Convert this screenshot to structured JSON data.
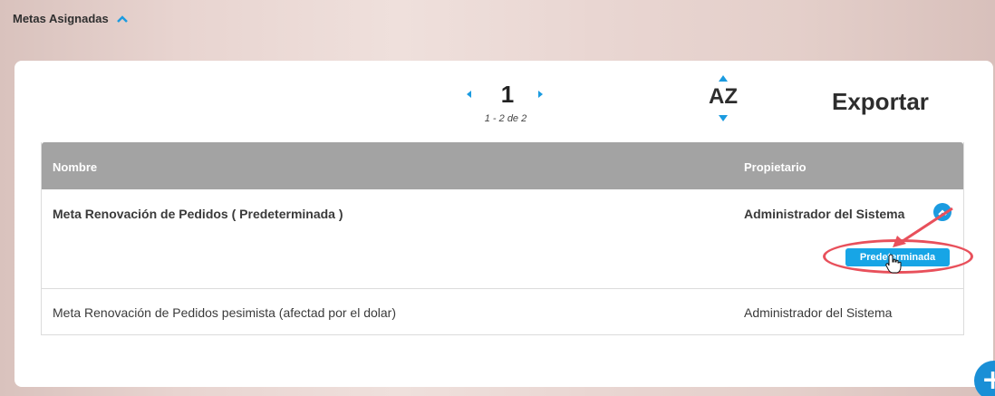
{
  "section": {
    "title": "Metas Asignadas"
  },
  "pagination": {
    "current_page": "1",
    "range": "1 - 2 de 2"
  },
  "sort": {
    "label": "AZ"
  },
  "export": {
    "label": "Exportar"
  },
  "table": {
    "columns": [
      "Nombre",
      "Propietario"
    ],
    "rows": [
      {
        "name": "Meta Renovación de Pedidos ( Predeterminada )",
        "owner": "Administrador del Sistema",
        "badge": "Predeterminada"
      },
      {
        "name": "Meta Renovación de Pedidos pesimista (afectad por el dolar)",
        "owner": "Administrador del Sistema"
      }
    ]
  },
  "colors": {
    "accent": "#1b9be0",
    "header_bg": "#a3a3a3",
    "annotation": "#e8505b"
  },
  "fab": {
    "label": "+"
  }
}
